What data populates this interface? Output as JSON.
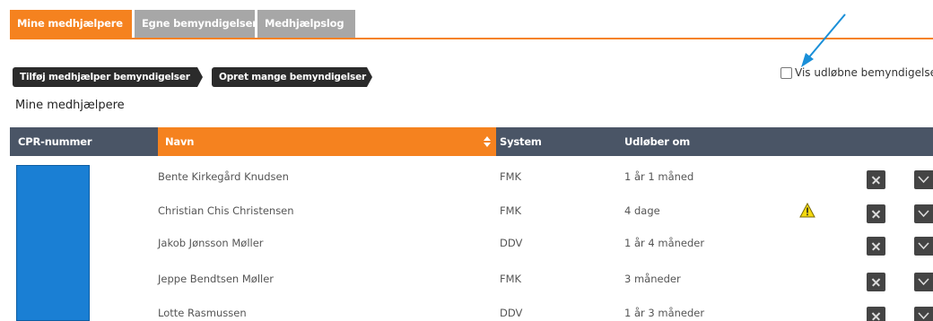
{
  "tabs": [
    {
      "label": "Mine medhjælpere",
      "active": true
    },
    {
      "label": "Egne bemyndigelser",
      "active": false
    },
    {
      "label": "Medhjælpslog",
      "active": false
    }
  ],
  "actions": {
    "add_label": "Tilføj medhjælper bemyndigelser",
    "create_many_label": "Opret mange bemyndigelser"
  },
  "show_expired": {
    "label": "Vis udløbne bemyndigelser",
    "checked": false
  },
  "section_title": "Mine medhjælpere",
  "table": {
    "columns": {
      "cpr": "CPR-nummer",
      "navn": "Navn",
      "system": "System",
      "udloeber": "Udløber om"
    },
    "rows": [
      {
        "navn": "Bente Kirkegård Knudsen",
        "system": "FMK",
        "udloeber": "1 år 1 måned",
        "warning": false
      },
      {
        "navn": "Christian Chis Christensen",
        "system": "FMK",
        "udloeber": "4 dage",
        "warning": true
      },
      {
        "navn": "Jakob Jønsson Møller",
        "system": "DDV",
        "udloeber": "1 år 4 måneder",
        "warning": false
      },
      {
        "navn": "Jeppe Bendtsen Møller",
        "system": "FMK",
        "udloeber": "3 måneder",
        "warning": false
      },
      {
        "navn": "Lotte Rasmussen",
        "system": "DDV",
        "udloeber": "1 år 3 måneder",
        "warning": false
      }
    ]
  },
  "colors": {
    "accent": "#f5821f",
    "header": "#4a5566",
    "redaction": "#1a7fd4",
    "annotation_arrow": "#1a8fd8"
  }
}
